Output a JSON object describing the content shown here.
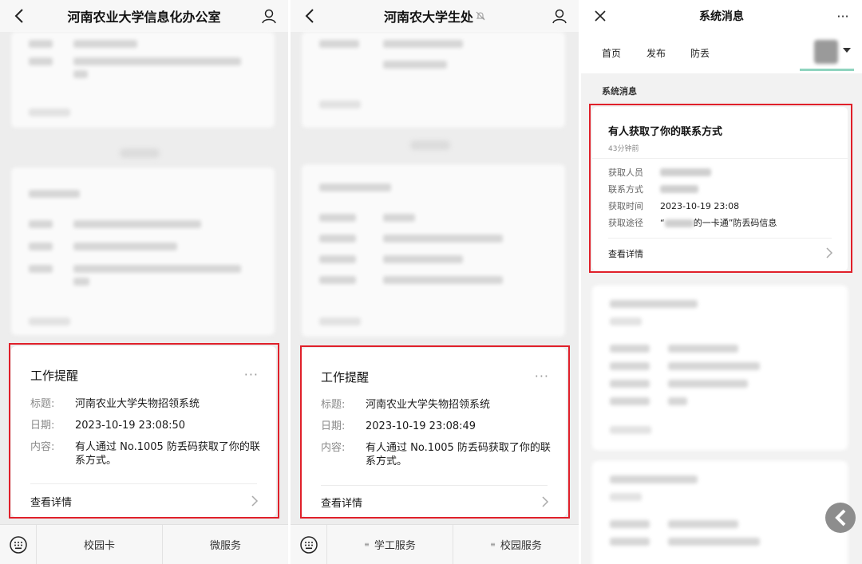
{
  "panel1": {
    "title": "河南农业大学信息化办公室",
    "reminder": {
      "heading": "工作提醒",
      "more": "···",
      "title_key": "标题:",
      "title_value": "河南农业大学失物招领系统",
      "date_key": "日期:",
      "date_value": "2023-10-19 23:08:50",
      "content_key": "内容:",
      "content_line1": "有人通过 No.1005 防丢码获取了你的联",
      "content_line2": "系方式。",
      "detail": "查看详情"
    },
    "menus": [
      "校园卡",
      "微服务"
    ]
  },
  "panel2": {
    "title": "河南农大学生处",
    "reminder": {
      "heading": "工作提醒",
      "more": "···",
      "title_key": "标题:",
      "title_value": "河南农业大学失物招领系统",
      "date_key": "日期:",
      "date_value": "2023-10-19 23:08:49",
      "content_key": "内容:",
      "content_line1": "有人通过 No.1005 防丢码获取了你的联",
      "content_line2": "系方式。",
      "detail": "查看详情"
    },
    "menus": [
      "学工服务",
      "校园服务"
    ]
  },
  "panel3": {
    "title": "系统消息",
    "more": "···",
    "tabs": [
      "首页",
      "发布",
      "防丢"
    ],
    "section": "系统消息",
    "message": {
      "title": "有人获取了你的联系方式",
      "time": "43分钟前",
      "k1": "获取人员",
      "k2": "联系方式",
      "k3": "获取时间",
      "v3": "2023-10-19 23:08",
      "k4": "获取途径",
      "v4_prefix": "“",
      "v4_suffix": "的一卡通”防丢码信息",
      "detail": "查看详情"
    }
  },
  "colors": {
    "highlight": "#e0202a",
    "tab_underline": "#8fd4bf"
  }
}
